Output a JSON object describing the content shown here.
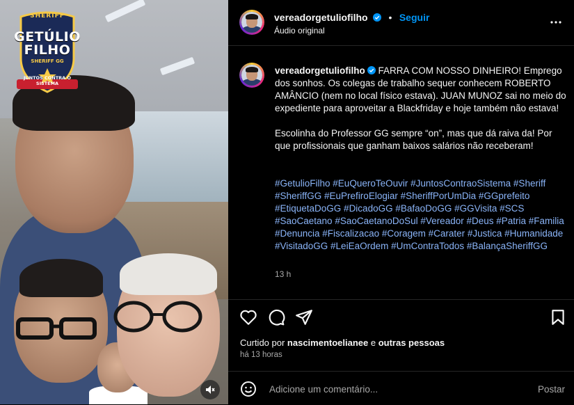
{
  "media": {
    "badge": {
      "top": "SHERIFF",
      "name_line1": "GETÚLIO",
      "name_line2": "FILHO",
      "subtitle": "SHERIFF GG",
      "bottom": "JUNTOS CONTRA O SISTEMA"
    },
    "audio_icon": "speaker-muted-icon"
  },
  "header": {
    "username": "vereadorgetuliofilho",
    "follow_label": "Seguir",
    "audio_label": "Áudio original",
    "more_icon": "more-horizontal-icon"
  },
  "caption": {
    "username": "vereadorgetuliofilho",
    "text": " FARRA COM NOSSO DINHEIRO! Emprego dos sonhos. Os colegas de trabalho sequer conhecem ROBERTO AMÂNCIO (nem no local físico estava). JUAN MUNOZ sai no meio do expediente para aproveitar a Blackfriday e hoje também não estava!\n\nEscolinha do Professor GG sempre “on”, mas que dá raiva da! Por que profissionais que ganham baixos salários não receberam!",
    "hashtags": "#GetulioFilho #EuQueroTeOuvir #JuntosContraoSistema #Sheriff #SheriffGG #EuPrefiroElogiar #SheriffPorUmDia #GGprefeito #EtiquetaDoGG #DicadoGG #BafaoDoGG #GGVisita #SCS #SaoCaetano #SaoCaetanoDoSul #Vereador #Deus #Patria #Familia #Denuncia #Fiscalizacao #Coragem #Carater #Justica #Humanidade #VisitadoGG #LeiEaOrdem #UmContraTodos #BalançaSheriffGG",
    "time": "13 h"
  },
  "likes": {
    "prefix": "Curtido por ",
    "user": "nascimentoelianee",
    "middle": " e ",
    "others": "outras pessoas",
    "ago": "há 13 horas"
  },
  "comment": {
    "placeholder": "Adicione um comentário...",
    "post_label": "Postar"
  },
  "colors": {
    "background": "#000000",
    "link": "#0095f6",
    "hashtag": "#8ab4f8",
    "muted": "#a8a8a8"
  }
}
